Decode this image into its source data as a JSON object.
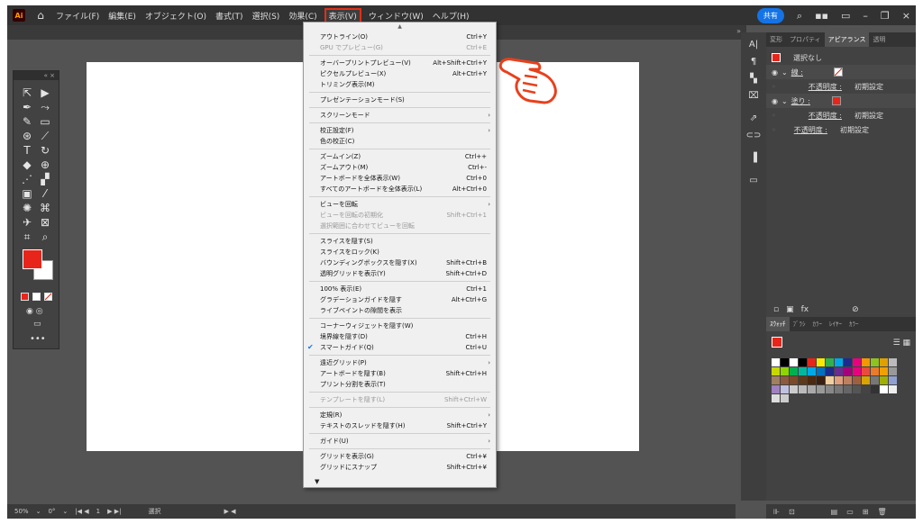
{
  "app": {
    "logo": "Ai",
    "home": "⌂"
  },
  "menubar": [
    "ファイル(F)",
    "編集(E)",
    "オブジェクト(O)",
    "書式(T)",
    "選択(S)",
    "効果(C)",
    "表示(V)",
    "ウィンドウ(W)",
    "ヘルプ(H)"
  ],
  "share_label": "共有",
  "view_menu": [
    {
      "label": "アウトライン(O)",
      "sc": "Ctrl+Y"
    },
    {
      "label": "GPU でプレビュー(G)",
      "sc": "Ctrl+E",
      "disabled": true
    },
    {
      "sep": true
    },
    {
      "label": "オーバープリントプレビュー(V)",
      "sc": "Alt+Shift+Ctrl+Y"
    },
    {
      "label": "ピクセルプレビュー(X)",
      "sc": "Alt+Ctrl+Y"
    },
    {
      "label": "トリミング表示(M)",
      "sc": ""
    },
    {
      "sep": true
    },
    {
      "label": "プレゼンテーションモード(S)",
      "sc": ""
    },
    {
      "sep": true
    },
    {
      "label": "スクリーンモード",
      "sc": "",
      "sub": true
    },
    {
      "sep": true
    },
    {
      "label": "校正設定(F)",
      "sc": "",
      "sub": true
    },
    {
      "label": "色の校正(C)",
      "sc": ""
    },
    {
      "sep": true
    },
    {
      "label": "ズームイン(Z)",
      "sc": "Ctrl++"
    },
    {
      "label": "ズームアウト(M)",
      "sc": "Ctrl+-"
    },
    {
      "label": "アートボードを全体表示(W)",
      "sc": "Ctrl+0"
    },
    {
      "label": "すべてのアートボードを全体表示(L)",
      "sc": "Alt+Ctrl+0"
    },
    {
      "sep": true
    },
    {
      "label": "ビューを回転",
      "sc": "",
      "sub": true
    },
    {
      "label": "ビューを回転の初期化",
      "sc": "Shift+Ctrl+1",
      "disabled": true
    },
    {
      "label": "選択範囲に合わせてビューを回転",
      "sc": "",
      "disabled": true
    },
    {
      "sep": true
    },
    {
      "label": "スライスを隠す(S)",
      "sc": ""
    },
    {
      "label": "スライスをロック(K)",
      "sc": ""
    },
    {
      "label": "バウンディングボックスを隠す(X)",
      "sc": "Shift+Ctrl+B"
    },
    {
      "label": "透明グリッドを表示(Y)",
      "sc": "Shift+Ctrl+D"
    },
    {
      "sep": true
    },
    {
      "label": "100% 表示(E)",
      "sc": "Ctrl+1"
    },
    {
      "label": "グラデーションガイドを隠す",
      "sc": "Alt+Ctrl+G"
    },
    {
      "label": "ライブペイントの隙間を表示",
      "sc": ""
    },
    {
      "sep": true
    },
    {
      "label": "コーナーウィジェットを隠す(W)",
      "sc": ""
    },
    {
      "label": "境界線を隠す(D)",
      "sc": "Ctrl+H"
    },
    {
      "label": "スマートガイド(Q)",
      "sc": "Ctrl+U",
      "checked": true
    },
    {
      "sep": true
    },
    {
      "label": "遠近グリッド(P)",
      "sc": "",
      "sub": true
    },
    {
      "label": "アートボードを隠す(B)",
      "sc": "Shift+Ctrl+H"
    },
    {
      "label": "プリント分割を表示(T)",
      "sc": ""
    },
    {
      "sep": true
    },
    {
      "label": "テンプレートを隠す(L)",
      "sc": "Shift+Ctrl+W",
      "disabled": true
    },
    {
      "sep": true
    },
    {
      "label": "定規(R)",
      "sc": "",
      "sub": true
    },
    {
      "label": "テキストのスレッドを隠す(H)",
      "sc": "Shift+Ctrl+Y"
    },
    {
      "sep": true
    },
    {
      "label": "ガイド(U)",
      "sc": "",
      "sub": true
    },
    {
      "sep": true
    },
    {
      "label": "グリッドを表示(G)",
      "sc": "Ctrl+¥"
    },
    {
      "label": "グリッドにスナップ",
      "sc": "Shift+Ctrl+¥"
    }
  ],
  "panel_tabs": [
    "変形",
    "プロパティ",
    "アピアランス",
    "透明"
  ],
  "appearance": {
    "none": "選択なし",
    "stroke": "線 :",
    "fill": "塗り :",
    "opacity": "不透明度 :",
    "default": "初期設定"
  },
  "panel2_tabs": [
    "ｽｳｫｯﾁ",
    "ﾌﾞﾗｼ",
    "ｶﾗｰ",
    "ﾚｲﾔｰ",
    "ｶﾗｰ"
  ],
  "status": {
    "zoom": "50%",
    "angle": "0°",
    "page": "1",
    "tool": "選択"
  },
  "colors": {
    "accent": "#1473e6",
    "fill": "#e8251a",
    "hand": "#e8401c"
  }
}
